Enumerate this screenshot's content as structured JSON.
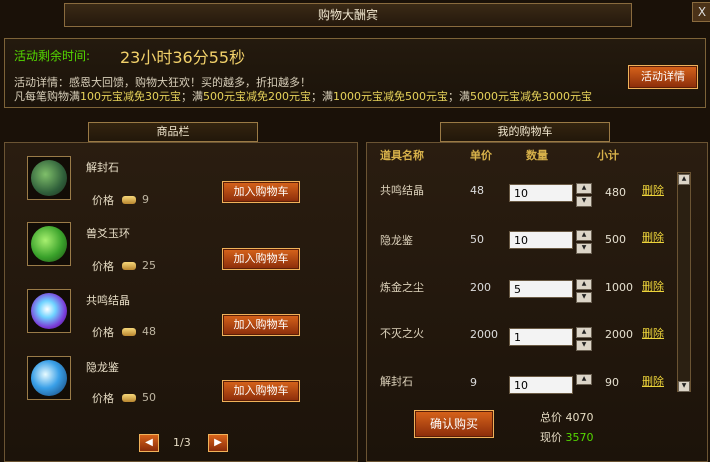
{
  "window": {
    "title": "购物大酬宾",
    "close_glyph": "X"
  },
  "activity": {
    "remaining_label": "活动剩余时间:",
    "remaining_time": "23小时36分55秒",
    "detail_line1": "活动详情：感恩大回馈，购物大狂欢！买的越多，折扣越多！",
    "detail_line2_parts": [
      "凡每笔购物满",
      "100元宝减免30元宝",
      "；满",
      "500元宝减免200元宝",
      "；满",
      "1000元宝减免500元宝",
      "；满",
      "5000元宝减免3000元宝"
    ],
    "details_button": "活动详情"
  },
  "products": {
    "tab_title": "商品栏",
    "price_label": "价格",
    "add_label": "加入购物车",
    "items": [
      {
        "name": "解封石",
        "price": "9"
      },
      {
        "name": "兽爻玉环",
        "price": "25"
      },
      {
        "name": "共鸣结晶",
        "price": "48"
      },
      {
        "name": "隐龙鉴",
        "price": "50"
      }
    ],
    "page": "1/3"
  },
  "cart": {
    "tab_title": "我的购物车",
    "headers": {
      "name": "道具名称",
      "price": "单价",
      "qty": "数量",
      "subtotal": "小计"
    },
    "delete_label": "删除",
    "rows": [
      {
        "name": "共鸣结晶",
        "price": "48",
        "qty": "10",
        "subtotal": "480"
      },
      {
        "name": "隐龙鉴",
        "price": "50",
        "qty": "10",
        "subtotal": "500"
      },
      {
        "name": "炼金之尘",
        "price": "200",
        "qty": "5",
        "subtotal": "1000"
      },
      {
        "name": "不灭之火",
        "price": "2000",
        "qty": "1",
        "subtotal": "2000"
      },
      {
        "name": "解封石",
        "price": "9",
        "qty": "10",
        "subtotal": "90"
      }
    ],
    "confirm_button": "确认购买",
    "total_label": "总价",
    "total_value": "4070",
    "current_label": "现价",
    "current_value": "3570"
  },
  "colors": {
    "accent_green": "#54d800",
    "accent_yellow": "#e6d25a",
    "button_orange": "#d8641b"
  }
}
